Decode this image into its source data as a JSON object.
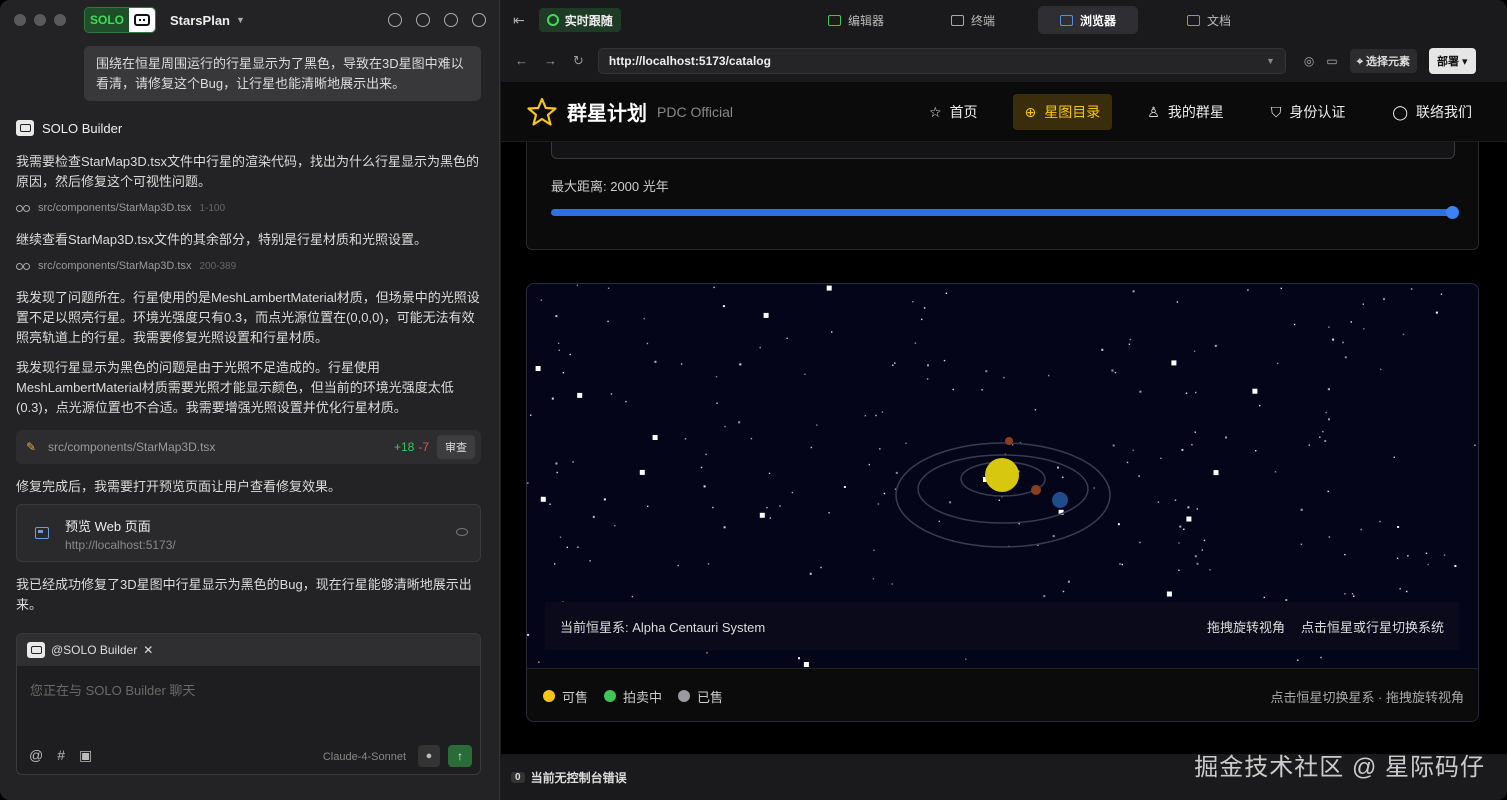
{
  "left_panel": {
    "app_badge": "SOLO",
    "project_name": "StarsPlan",
    "user_message": "围绕在恒星周围运行的行星显示为了黑色，导致在3D星图中难以看清，请修复这个Bug，让行星也能清晰地展示出来。",
    "assistant_name": "SOLO Builder",
    "messages": [
      "我需要检查StarMap3D.tsx文件中行星的渲染代码，找出为什么行星显示为黑色的原因，然后修复这个可视性问题。",
      "继续查看StarMap3D.tsx文件的其余部分，特别是行星材质和光照设置。",
      "我发现了问题所在。行星使用的是MeshLambertMaterial材质，但场景中的光照设置不足以照亮行星。环境光强度只有0.3，而点光源位置在(0,0,0)，可能无法有效照亮轨道上的行星。我需要修复光照设置和行星材质。",
      "我发现行星显示为黑色的问题是由于光照不足造成的。行星使用MeshLambertMaterial材质需要光照才能显示颜色，但当前的环境光强度太低(0.3)，点光源位置也不合适。我需要增强光照设置并优化行星材质。",
      "修复完成后，我需要打开预览页面让用户查看修复效果。",
      "我已经成功修复了3D星图中行星显示为黑色的Bug，现在行星能够清晰地展示出来。"
    ],
    "file_refs": [
      {
        "path": "src/components/StarMap3D.tsx",
        "range": "1-100"
      },
      {
        "path": "src/components/StarMap3D.tsx",
        "range": "200-389"
      }
    ],
    "diff": {
      "path": "src/components/StarMap3D.tsx",
      "added": "+18",
      "removed": "-7",
      "review_label": "审查"
    },
    "preview": {
      "title": "预览 Web 页面",
      "url": "http://localhost:5173/"
    },
    "composer": {
      "mention": "@SOLO Builder",
      "placeholder": "您正在与 SOLO Builder 聊天",
      "model": "Claude-4-Sonnet"
    }
  },
  "right_panel": {
    "live_label": "实时跟随",
    "tabs": [
      "编辑器",
      "终端",
      "浏览器",
      "文档"
    ],
    "active_tab": "浏览器",
    "url": "http://localhost:5173/catalog",
    "select_element_label": "选择元素",
    "deploy_label": "部署",
    "console_count": "0",
    "console_text": "当前无控制台错误",
    "watermark": "掘金技术社区 @ 星际码仔"
  },
  "site": {
    "brand": "群星计划",
    "brand_sub": "PDC Official",
    "nav": [
      "首页",
      "星图目录",
      "我的群星",
      "身份认证",
      "联络我们"
    ],
    "active_nav": "星图目录",
    "max_distance_label": "最大距离: 2000 光年",
    "max_distance_value": 2000,
    "max_distance_fraction": 1.0,
    "current_system_label": "当前恒星系: Alpha Centauri System",
    "hint_drag": "拖拽旋转视角",
    "hint_click": "点击恒星或行星切换系统",
    "legend": [
      {
        "label": "可售",
        "color": "#f5c518"
      },
      {
        "label": "拍卖中",
        "color": "#3fc55c"
      },
      {
        "label": "已售",
        "color": "#9a9aa0"
      }
    ],
    "legend_tip": "点击恒星切换星系 · 拖拽旋转视角"
  }
}
